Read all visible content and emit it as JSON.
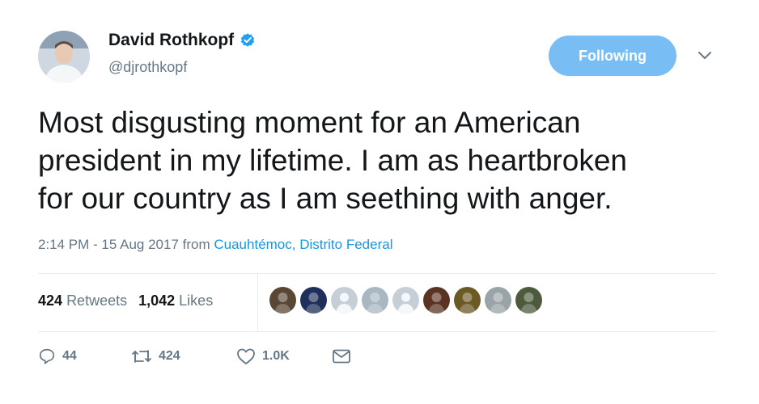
{
  "author": {
    "name": "David Rothkopf",
    "handle": "@djrothkopf",
    "verified": true,
    "avatar_icon": "profile-photo"
  },
  "follow_button": {
    "label": "Following"
  },
  "tweet": {
    "text": "Most disgusting moment for an American\npresident in my lifetime.  I am as heartbroken\nfor our country as I am seething with anger.",
    "timestamp": "2:14 PM - 15 Aug 2017",
    "from_label": "from",
    "location": "Cuauhtémoc, Distrito Federal"
  },
  "stats": {
    "retweets_count": "424",
    "retweets_label": "Retweets",
    "likes_count": "1,042",
    "likes_label": "Likes"
  },
  "likers": [
    {
      "icon": "liker-avatar-1",
      "color": "#5a4634"
    },
    {
      "icon": "liker-avatar-2",
      "color": "#1d2f5a"
    },
    {
      "icon": "liker-avatar-default",
      "color": "#c7cfd6"
    },
    {
      "icon": "liker-avatar-4",
      "color": "#a9b7c2"
    },
    {
      "icon": "liker-avatar-default",
      "color": "#c7cfd6"
    },
    {
      "icon": "liker-avatar-6",
      "color": "#5b3323"
    },
    {
      "icon": "liker-avatar-7",
      "color": "#6b5a24"
    },
    {
      "icon": "liker-avatar-8",
      "color": "#9aa3a8"
    },
    {
      "icon": "liker-avatar-9",
      "color": "#4e5a3c"
    }
  ],
  "actions": {
    "reply_count": "44",
    "retweet_count": "424",
    "like_count": "1.0K"
  },
  "colors": {
    "accent": "#1b95e0",
    "button_bg": "#78bdf4",
    "muted": "#657786",
    "text": "#14171a"
  }
}
